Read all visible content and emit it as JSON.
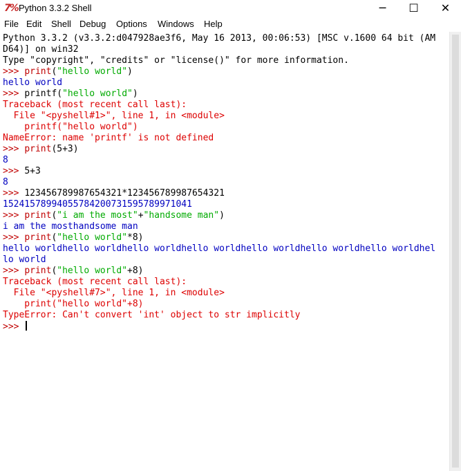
{
  "window": {
    "title": "Python 3.3.2 Shell",
    "icon": "idle-python-icon",
    "controls": {
      "minimize": "─",
      "maximize": "☐",
      "close": "✕"
    }
  },
  "menu": [
    "File",
    "Edit",
    "Shell",
    "Debug",
    "Options",
    "Windows",
    "Help"
  ],
  "colors": {
    "prompt": "#c00000",
    "output": "#0000c0",
    "string": "#00aa00",
    "error": "#dd0000",
    "code": "#000000",
    "header": "#000000"
  },
  "console_lines": [
    [
      {
        "t": "Python 3.3.2 (v3.3.2:d047928ae3f6, May 16 2013, 00:06:53) [MSC v.1600 64 bit (AM",
        "c": "header"
      }
    ],
    [
      {
        "t": "D64)] on win32",
        "c": "header"
      }
    ],
    [
      {
        "t": "Type \"copyright\", \"credits\" or \"license()\" for more information.",
        "c": "header"
      }
    ],
    [
      {
        "t": ">>> ",
        "c": "prompt"
      },
      {
        "t": "print",
        "c": "prompt"
      },
      {
        "t": "(",
        "c": "code"
      },
      {
        "t": "\"hello world\"",
        "c": "string"
      },
      {
        "t": ")",
        "c": "code"
      }
    ],
    [
      {
        "t": "hello world",
        "c": "output"
      }
    ],
    [
      {
        "t": ">>> ",
        "c": "prompt"
      },
      {
        "t": "printf(",
        "c": "code"
      },
      {
        "t": "\"hello world\"",
        "c": "string"
      },
      {
        "t": ")",
        "c": "code"
      }
    ],
    [
      {
        "t": "Traceback (most recent call last):",
        "c": "error"
      }
    ],
    [
      {
        "t": "  File \"<pyshell#1>\", line 1, in <module>",
        "c": "error"
      }
    ],
    [
      {
        "t": "    printf(\"hello world\")",
        "c": "error"
      }
    ],
    [
      {
        "t": "NameError: name 'printf' is not defined",
        "c": "error"
      }
    ],
    [
      {
        "t": ">>> ",
        "c": "prompt"
      },
      {
        "t": "print",
        "c": "prompt"
      },
      {
        "t": "(5+3)",
        "c": "code"
      }
    ],
    [
      {
        "t": "8",
        "c": "output"
      }
    ],
    [
      {
        "t": ">>> ",
        "c": "prompt"
      },
      {
        "t": "5+3",
        "c": "code"
      }
    ],
    [
      {
        "t": "8",
        "c": "output"
      }
    ],
    [
      {
        "t": ">>> ",
        "c": "prompt"
      },
      {
        "t": "123456789987654321*123456789987654321",
        "c": "code"
      }
    ],
    [
      {
        "t": "15241578994055784200731595789971041",
        "c": "output"
      }
    ],
    [
      {
        "t": ">>> ",
        "c": "prompt"
      },
      {
        "t": "print",
        "c": "prompt"
      },
      {
        "t": "(",
        "c": "code"
      },
      {
        "t": "\"i am the most\"",
        "c": "string"
      },
      {
        "t": "+",
        "c": "code"
      },
      {
        "t": "\"handsome man\"",
        "c": "string"
      },
      {
        "t": ")",
        "c": "code"
      }
    ],
    [
      {
        "t": "i am the mosthandsome man",
        "c": "output"
      }
    ],
    [
      {
        "t": ">>> ",
        "c": "prompt"
      },
      {
        "t": "print",
        "c": "prompt"
      },
      {
        "t": "(",
        "c": "code"
      },
      {
        "t": "\"hello world\"",
        "c": "string"
      },
      {
        "t": "*8)",
        "c": "code"
      }
    ],
    [
      {
        "t": "hello worldhello worldhello worldhello worldhello worldhello worldhello worldhel",
        "c": "output"
      }
    ],
    [
      {
        "t": "lo world",
        "c": "output"
      }
    ],
    [
      {
        "t": ">>> ",
        "c": "prompt"
      },
      {
        "t": "print",
        "c": "prompt"
      },
      {
        "t": "(",
        "c": "code"
      },
      {
        "t": "\"hello world\"",
        "c": "string"
      },
      {
        "t": "+8)",
        "c": "code"
      }
    ],
    [
      {
        "t": "Traceback (most recent call last):",
        "c": "error"
      }
    ],
    [
      {
        "t": "  File \"<pyshell#7>\", line 1, in <module>",
        "c": "error"
      }
    ],
    [
      {
        "t": "    print(\"hello world\"+8)",
        "c": "error"
      }
    ],
    [
      {
        "t": "TypeError: Can't convert 'int' object to str implicitly",
        "c": "error"
      }
    ]
  ],
  "input_prompt": ">>> "
}
